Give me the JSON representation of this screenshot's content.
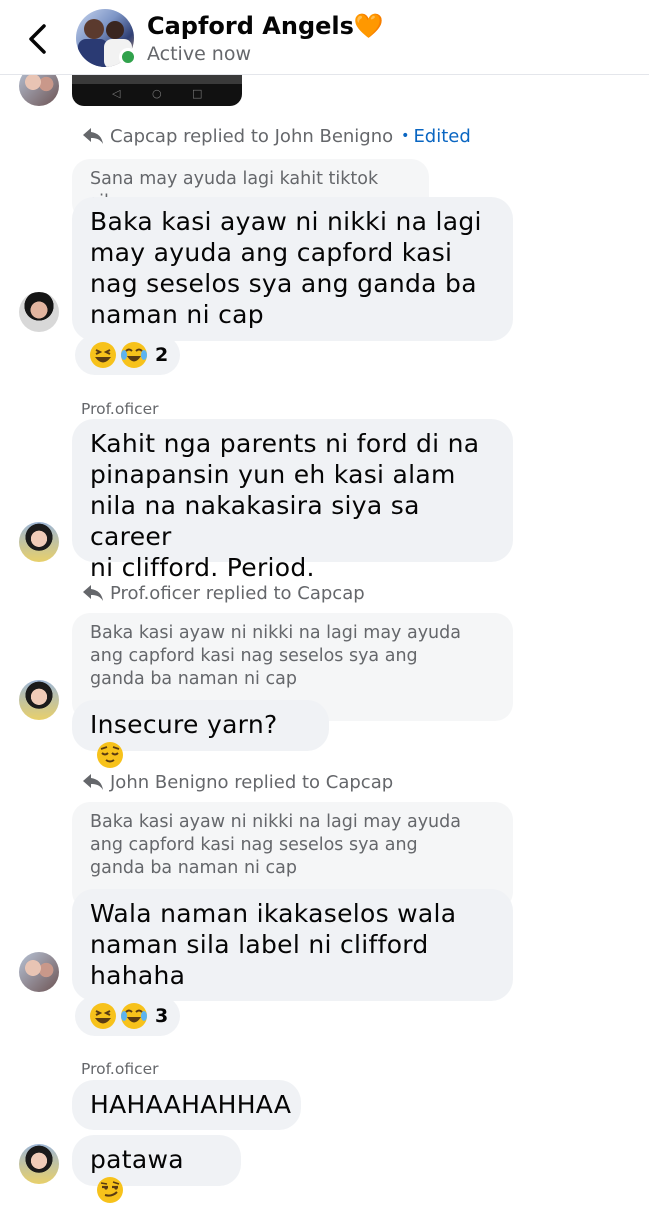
{
  "header": {
    "title": "Capford Angels🧡",
    "status": "Active now"
  },
  "messages": {
    "m1": {
      "reply_context": "Capcap replied to John Benigno",
      "edited": "Edited",
      "quote": "Sana may ayuda lagi kahit tiktok sila",
      "text": [
        "Baka kasi ayaw ni nikki na lagi",
        "may ayuda ang capford  kasi",
        "nag seselos sya ang ganda ba",
        "naman ni cap"
      ],
      "reaction_count": "2"
    },
    "m2": {
      "sender": "Prof.oficer",
      "text": [
        "Kahit nga parents ni ford di na",
        "pinapansin yun eh kasi alam",
        "nila na nakakasira siya sa career",
        "ni clifford. Period."
      ]
    },
    "m3": {
      "reply_context": "Prof.oficer replied to Capcap",
      "quote": [
        "Baka kasi ayaw ni nikki na lagi may ayuda",
        "ang capford  kasi nag seselos sya ang",
        "ganda ba naman ni cap"
      ],
      "text": "Insecure yarn?"
    },
    "m4": {
      "reply_context": "John Benigno replied to Capcap",
      "quote": [
        "Baka kasi ayaw ni nikki na lagi may ayuda",
        "ang capford  kasi nag seselos sya ang",
        "ganda ba naman ni cap"
      ],
      "text": [
        "Wala naman ikakaselos wala",
        "naman sila label ni clifford",
        "hahaha"
      ],
      "reaction_count": "3"
    },
    "m5": {
      "sender": "Prof.oficer",
      "text": "HAHAAHAHHAA"
    },
    "m6": {
      "text": "patawa"
    }
  }
}
